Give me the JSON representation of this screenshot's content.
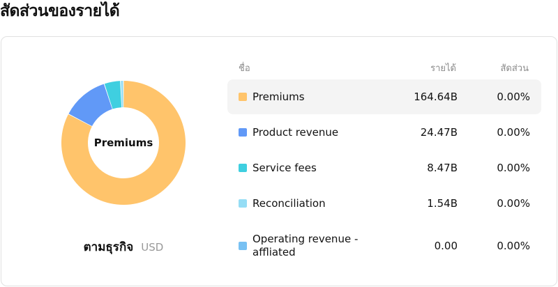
{
  "page": {
    "title": "สัดส่วนของรายได้"
  },
  "chart": {
    "center_label": "Premiums",
    "caption_main": "ตามธุรกิจ",
    "caption_unit": "USD"
  },
  "table": {
    "headers": {
      "name": "ชื่อ",
      "revenue": "รายได้",
      "share": "สัดส่วน"
    },
    "rows": [
      {
        "name": "Premiums",
        "revenue": "164.64B",
        "share": "0.00%",
        "color": "#FFC46B",
        "active": true
      },
      {
        "name": "Product revenue",
        "revenue": "24.47B",
        "share": "0.00%",
        "color": "#6199F7",
        "active": false
      },
      {
        "name": "Service fees",
        "revenue": "8.47B",
        "share": "0.00%",
        "color": "#3FCFE0",
        "active": false
      },
      {
        "name": "Reconciliation",
        "revenue": "1.54B",
        "share": "0.00%",
        "color": "#95DDF5",
        "active": false
      },
      {
        "name": "Operating revenue - affliated",
        "revenue": "0.00",
        "share": "0.00%",
        "color": "#78C1F3",
        "active": false
      }
    ]
  },
  "chart_data": {
    "type": "pie",
    "categories": [
      "Premiums",
      "Product revenue",
      "Service fees",
      "Reconciliation",
      "Operating revenue - affliated"
    ],
    "values": [
      164.64,
      24.47,
      8.47,
      1.54,
      0.0
    ],
    "unit": "B USD",
    "donut": true
  }
}
